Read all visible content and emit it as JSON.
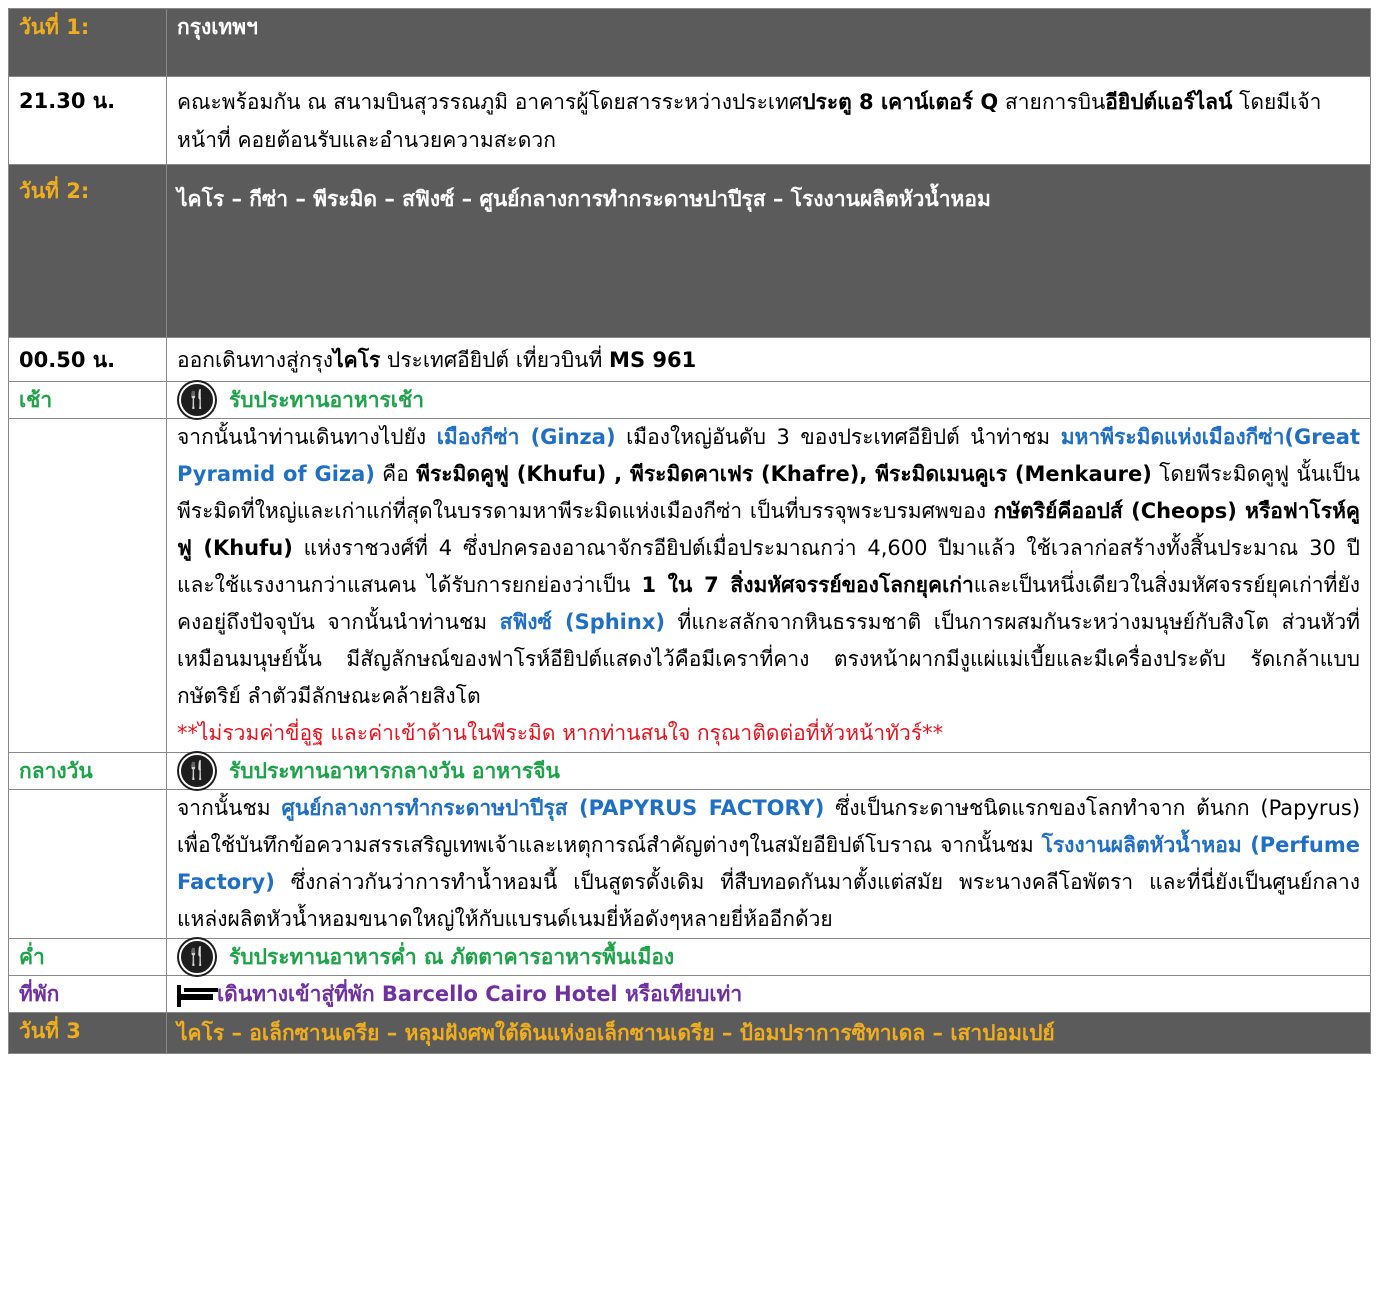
{
  "day1": {
    "label": "วันที่ 1:",
    "title": "กรุงเทพฯ",
    "time": "21.30 น.",
    "t1": "คณะพร้อมกัน ณ สนามบินสุวรรณภูมิ อาคารผู้โดยสารระหว่างประเทศ",
    "b1": "ประตู 8 เคาน์เตอร์ Q",
    "t2": " สายการบิน",
    "b2": "อียิปต์แอร์ไลน์",
    "t3": " โดยมีเจ้าหน้าที่ คอยต้อนรับและอำนวยความสะดวก"
  },
  "day2": {
    "label": "วันที่ 2:",
    "title": "ไคโร – กีซ่า – พีระมิด – สฟิงซ์ – ศูนย์กลางการทำกระดาษปาปีรุส – โรงงานผลิตหัวน้ำหอม",
    "time": "00.50 น.",
    "f1": "ออกเดินทางสู่กรุง",
    "f2": "ไคโร",
    "f3": " ประเทศอียิปต์ เที่ยวบินที่ ",
    "f4": "MS 961",
    "breakfast_label": "เช้า",
    "breakfast_text": "รับประทานอาหารเช้า",
    "p1": {
      "a": "จากนั้นนำท่านเดินทางไปยัง ",
      "b": "เมืองกีซ่า (Ginza)",
      "c": " เมืองใหญ่อันดับ 3 ของประเทศอียิปต์ นำท่าชม ",
      "d": "มหาพีระมิดแห่งเมืองกีซ่า(Great Pyramid of Giza)",
      "e": " คือ ",
      "f": "พีระมิดคูฟู (Khufu) , พีระมิดคาเฟร (Khafre), พีระมิดเมนคูเร (Menkaure)",
      "g": " โดยพีระมิดคูฟู นั้นเป็นพีระมิดที่ใหญ่และเก่าแก่ที่สุดในบรรดามหาพีระมิดแห่งเมืองกีซ่า เป็นที่บรรจุพระบรมศพของ ",
      "h": "กษัตริย์คีออปส์ (Cheops) หรือฟาโรห์คูฟู (Khufu)",
      "i": " แห่งราชวงศ์ที่ 4 ซึ่งปกครองอาณาจักรอียิปต์เมื่อประมาณกว่า 4,600 ปีมาแล้ว ใช้เวลาก่อสร้างทั้งสิ้นประมาณ 30 ปี และใช้แรงงานกว่าแสนคน ได้รับการยกย่องว่าเป็น ",
      "j": "1 ใน 7 สิ่งมหัศจรรย์ของโลกยุคเก่า",
      "k": "และเป็นหนึ่งเดียวในสิ่งมหัศจรรย์ยุคเก่าที่ยังคงอยู่ถึงปัจจุบัน จากนั้นนำท่านชม ",
      "l": "สฟิงซ์ (Sphinx)",
      "m": " ที่แกะสลักจากหินธรรมชาติ เป็นการผสมกันระหว่างมนุษย์กับสิงโต ส่วนหัวที่เหมือนมนุษย์นั้น มีสัญลักษณ์ของฟาโรห์อียิปต์แสดงไว้คือมีเคราที่คาง ตรงหน้าผากมีงูแผ่แม่เบี้ยและมีเครื่องประดับ รัดเกล้าแบบกษัตริย์ ลำตัวมีลักษณะคล้ายสิงโต",
      "note": "**ไม่รวมค่าขี่อูฐ และค่าเข้าด้านในพีระมิด หากท่านสนใจ กรุณาติดต่อที่หัวหน้าทัวร์**"
    },
    "lunch_label": "กลางวัน",
    "lunch_text": "รับประทานอาหารกลางวัน อาหารจีน",
    "p2": {
      "a": "จากนั้นชม ",
      "b": "ศูนย์กลางการทำกระดาษปาปีรุส (PAPYRUS FACTORY)",
      "c": " ซึ่งเป็นกระดาษชนิดแรกของโลกทำจาก ต้นกก (Papyrus) เพื่อใช้บันทึกข้อความสรรเสริญเทพเจ้าและเหตุการณ์สำคัญต่างๆในสมัยอียิปต์โบราณ จากนั้นชม ",
      "d": "โรงงานผลิตหัวน้ำหอม (Perfume Factory)",
      "e": " ซึ่งกล่าวกันว่าการทำน้ำหอมนี้ เป็นสูตรดั้งเดิม ที่สืบทอดกันมาตั้งแต่สมัย พระนางคลีโอพัตรา และที่นี่ยังเป็นศูนย์กลางแหล่งผลิตหัวน้ำหอมขนาดใหญ่ให้กับแบรนด์เนมยี่ห้อดังๆหลายยี่ห้ออีกด้วย"
    },
    "dinner_label": "ค่ำ",
    "dinner_text": "รับประทานอาหารค่ำ ณ ภัตตาคารอาหารพื้นเมือง",
    "hotel_label": "ที่พัก",
    "hotel_text": "เดินทางเข้าสู่ที่พัก Barcello Cairo Hotel  หรือเทียบเท่า"
  },
  "day3": {
    "label": "วันที่ 3",
    "title": "ไคโร – อเล็กซานเดรีย – หลุมฝังศพใต้ดินแห่งอเล็กซานเดรีย –  ป้อมปราการซิทาเดล – เสาปอมเปย์"
  },
  "icons": {
    "meal": "fork-knife-plate-icon",
    "hotel": "bed-icon"
  },
  "colors": {
    "header_bg": "#5b5b5b",
    "day_label": "#f0ad1e",
    "green": "#1ea34a",
    "blue": "#1f6fc4",
    "red": "#e8121f",
    "purple": "#7030a0"
  }
}
